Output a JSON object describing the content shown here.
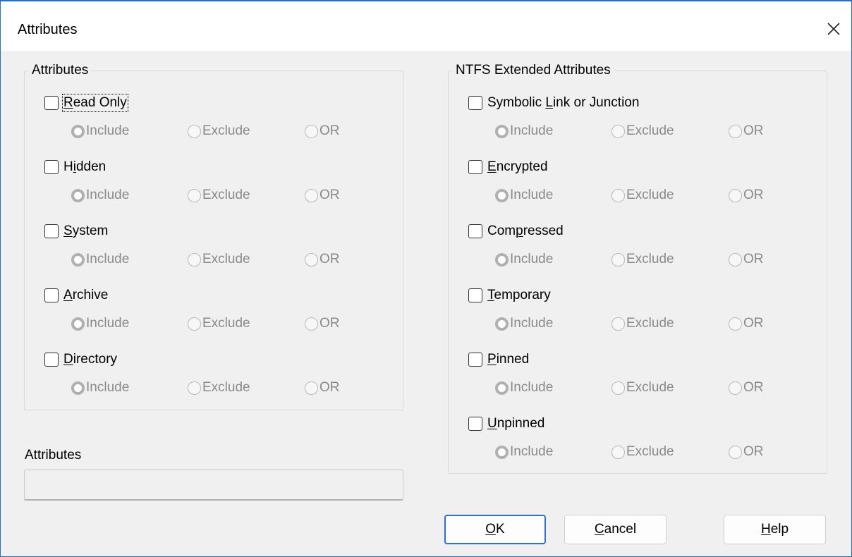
{
  "window": {
    "title": "Attributes"
  },
  "left_group": {
    "legend": "Attributes",
    "items": [
      {
        "label": "Read Only",
        "mnemonic": "R",
        "checked": false,
        "focused": true,
        "options": [
          "Include",
          "Exclude",
          "OR"
        ],
        "selected": "Include"
      },
      {
        "label": "Hidden",
        "mnemonic": "i",
        "checked": false,
        "options": [
          "Include",
          "Exclude",
          "OR"
        ],
        "selected": "Include"
      },
      {
        "label": "System",
        "mnemonic": "S",
        "checked": false,
        "options": [
          "Include",
          "Exclude",
          "OR"
        ],
        "selected": "Include"
      },
      {
        "label": "Archive",
        "mnemonic": "A",
        "checked": false,
        "options": [
          "Include",
          "Exclude",
          "OR"
        ],
        "selected": "Include"
      },
      {
        "label": "Directory",
        "mnemonic": "D",
        "checked": false,
        "options": [
          "Include",
          "Exclude",
          "OR"
        ],
        "selected": "Include"
      }
    ]
  },
  "right_group": {
    "legend": "NTFS Extended Attributes",
    "items": [
      {
        "label": "Symbolic Link or Junction",
        "mnemonic": "L",
        "checked": false,
        "options": [
          "Include",
          "Exclude",
          "OR"
        ],
        "selected": "Include"
      },
      {
        "label": "Encrypted",
        "mnemonic": "E",
        "checked": false,
        "options": [
          "Include",
          "Exclude",
          "OR"
        ],
        "selected": "Include"
      },
      {
        "label": "Compressed",
        "mnemonic": "p",
        "checked": false,
        "options": [
          "Include",
          "Exclude",
          "OR"
        ],
        "selected": "Include"
      },
      {
        "label": "Temporary",
        "mnemonic": "T",
        "checked": false,
        "options": [
          "Include",
          "Exclude",
          "OR"
        ],
        "selected": "Include"
      },
      {
        "label": "Pinned",
        "mnemonic": "P",
        "checked": false,
        "options": [
          "Include",
          "Exclude",
          "OR"
        ],
        "selected": "Include"
      },
      {
        "label": "Unpinned",
        "mnemonic": "U",
        "checked": false,
        "options": [
          "Include",
          "Exclude",
          "OR"
        ],
        "selected": "Include"
      }
    ]
  },
  "attributes_field": {
    "label": "Attributes",
    "value": ""
  },
  "buttons": {
    "ok": {
      "label": "OK",
      "mnemonic": "O"
    },
    "cancel": {
      "label": "Cancel",
      "mnemonic": "C"
    },
    "help": {
      "label": "Help",
      "mnemonic": "H"
    }
  },
  "colors": {
    "accent": "#2a73d6",
    "disabled_text": "#8a8a8a"
  }
}
